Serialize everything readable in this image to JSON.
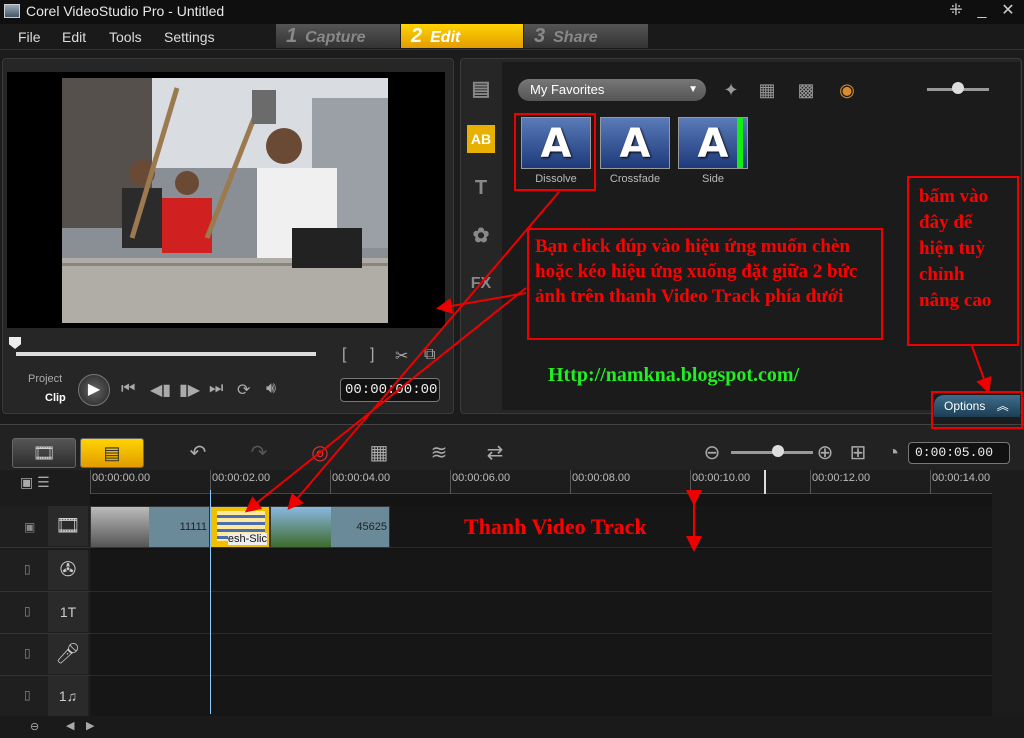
{
  "window": {
    "title": "Corel VideoStudio Pro - Untitled"
  },
  "menu": [
    "File",
    "Edit",
    "Tools",
    "Settings"
  ],
  "steps": [
    {
      "num": "1",
      "label": "Capture"
    },
    {
      "num": "2",
      "label": "Edit"
    },
    {
      "num": "3",
      "label": "Share"
    }
  ],
  "player": {
    "project_label": "Project",
    "clip_label": "Clip",
    "timecode": "00:00:00:00"
  },
  "library": {
    "dropdown": "My Favorites",
    "thumbs": [
      {
        "label": "Dissolve"
      },
      {
        "label": "Crossfade"
      },
      {
        "label": "Side"
      }
    ],
    "letter": "A"
  },
  "options_label": "Options",
  "timeline": {
    "duration": "0:00:05.00",
    "ticks": [
      "00:00:00.00",
      "00:00:02.00",
      "00:00:04.00",
      "00:00:06.00",
      "00:00:08.00",
      "00:00:10.00",
      "00:00:12.00",
      "00:00:14.00"
    ],
    "clips": [
      {
        "label": "11111"
      },
      {
        "label": "esh-Slic"
      },
      {
        "label": "45625"
      }
    ]
  },
  "annotations": {
    "main": "Bạn click đúp vào hiệu ứng muốn chèn hoặc kéo hiệu ứng xuống đặt giữa 2 bức ảnh trên thanh Video Track phía dưới",
    "options": "bấm vào đây để hiện tuỳ chỉnh nâng cao",
    "url": "Http://namkna.blogspot.com/",
    "track": "Thanh Video Track"
  },
  "colors": {
    "edit_tab": "#ffd400",
    "annotation": "#ee0000",
    "url": "#22ee22"
  }
}
